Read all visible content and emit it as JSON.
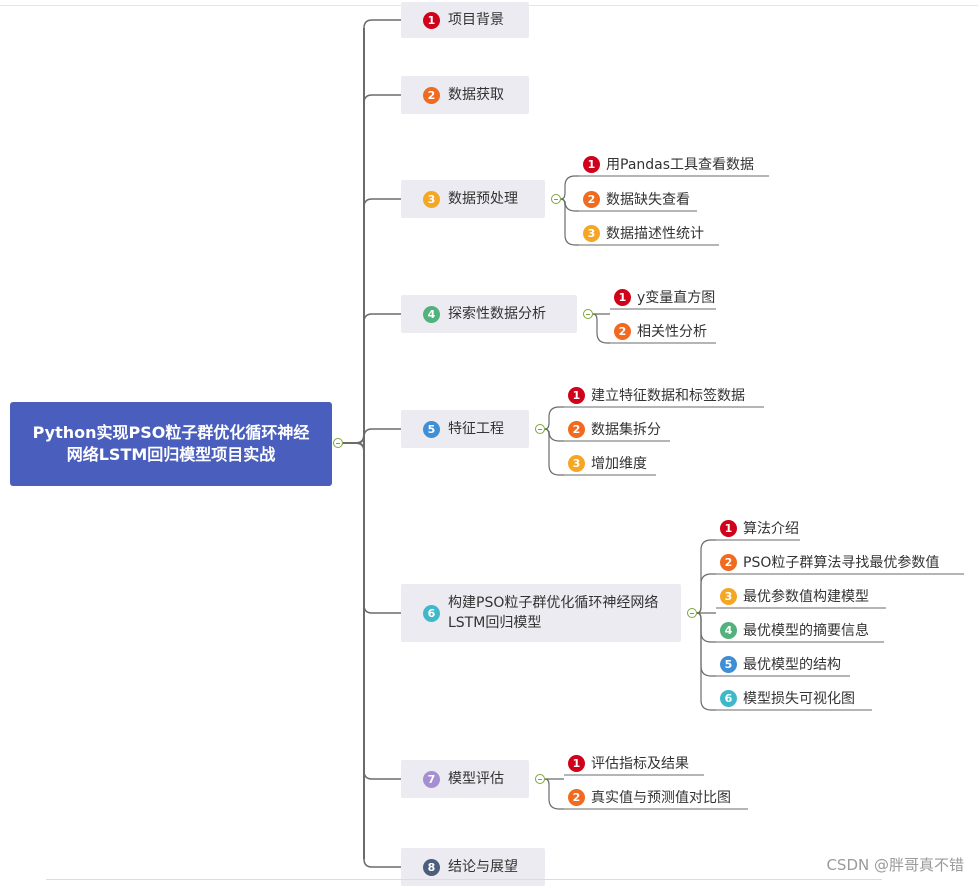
{
  "root": {
    "title": "Python实现PSO粒子群优化循环神经网络LSTM回归模型项目实战"
  },
  "colors": {
    "root_bg": "#4a5fbd",
    "branch_bg": "#ebebf1",
    "connector": "#6b6b6b",
    "num": [
      "#d0021b",
      "#f06a20",
      "#f5a623",
      "#52b27d",
      "#3e8fd6",
      "#3fb9c9",
      "#a58ed2",
      "#4b5e7a"
    ],
    "toggle": "#7aa73a"
  },
  "branches": [
    {
      "num": "1",
      "label": "项目背景",
      "children": []
    },
    {
      "num": "2",
      "label": "数据获取",
      "children": []
    },
    {
      "num": "3",
      "label": "数据预处理",
      "children": [
        {
          "num": "1",
          "label": "用Pandas工具查看数据"
        },
        {
          "num": "2",
          "label": "数据缺失查看"
        },
        {
          "num": "3",
          "label": "数据描述性统计"
        }
      ]
    },
    {
      "num": "4",
      "label": "探索性数据分析",
      "children": [
        {
          "num": "1",
          "label": "y变量直方图"
        },
        {
          "num": "2",
          "label": "相关性分析"
        }
      ]
    },
    {
      "num": "5",
      "label": "特征工程",
      "children": [
        {
          "num": "1",
          "label": "建立特征数据和标签数据"
        },
        {
          "num": "2",
          "label": "数据集拆分"
        },
        {
          "num": "3",
          "label": "增加维度"
        }
      ]
    },
    {
      "num": "6",
      "label": "构建PSO粒子群优化循环神经网络LSTM回归模型",
      "children": [
        {
          "num": "1",
          "label": "算法介绍"
        },
        {
          "num": "2",
          "label": "PSO粒子群算法寻找最优参数值"
        },
        {
          "num": "3",
          "label": "最优参数值构建模型"
        },
        {
          "num": "4",
          "label": "最优模型的摘要信息"
        },
        {
          "num": "5",
          "label": "最优模型的结构"
        },
        {
          "num": "6",
          "label": "模型损失可视化图"
        }
      ]
    },
    {
      "num": "7",
      "label": "模型评估",
      "children": [
        {
          "num": "1",
          "label": "评估指标及结果"
        },
        {
          "num": "2",
          "label": "真实值与预测值对比图"
        }
      ]
    },
    {
      "num": "8",
      "label": "结论与展望",
      "children": []
    }
  ],
  "watermark": "CSDN @胖哥真不错"
}
